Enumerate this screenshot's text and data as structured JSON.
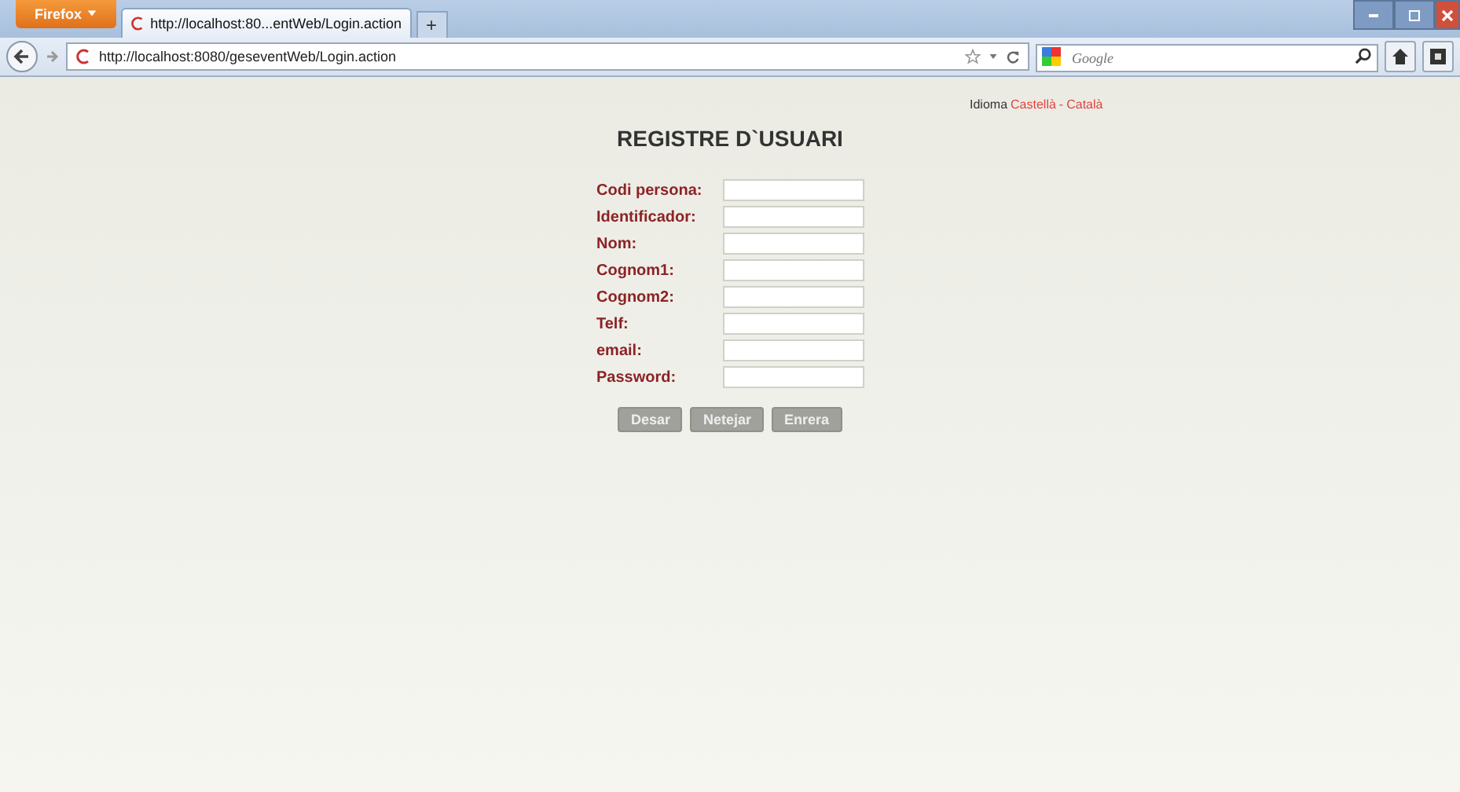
{
  "browser": {
    "menu_button": "Firefox",
    "tab_title": "http://localhost:80...entWeb/Login.action",
    "new_tab": "+",
    "url": "http://localhost:8080/geseventWeb/Login.action",
    "search_placeholder": "Google"
  },
  "language": {
    "label": "Idioma",
    "options": [
      "Castellà",
      "Català"
    ],
    "separator": "-"
  },
  "title": "REGISTRE D`USUARI",
  "fields": [
    {
      "label": "Codi persona:"
    },
    {
      "label": "Identificador:"
    },
    {
      "label": "Nom:"
    },
    {
      "label": "Cognom1:"
    },
    {
      "label": "Cognom2:"
    },
    {
      "label": "Telf:"
    },
    {
      "label": "email:"
    },
    {
      "label": "Password:"
    }
  ],
  "buttons": [
    "Desar",
    "Netejar",
    "Enrera"
  ]
}
